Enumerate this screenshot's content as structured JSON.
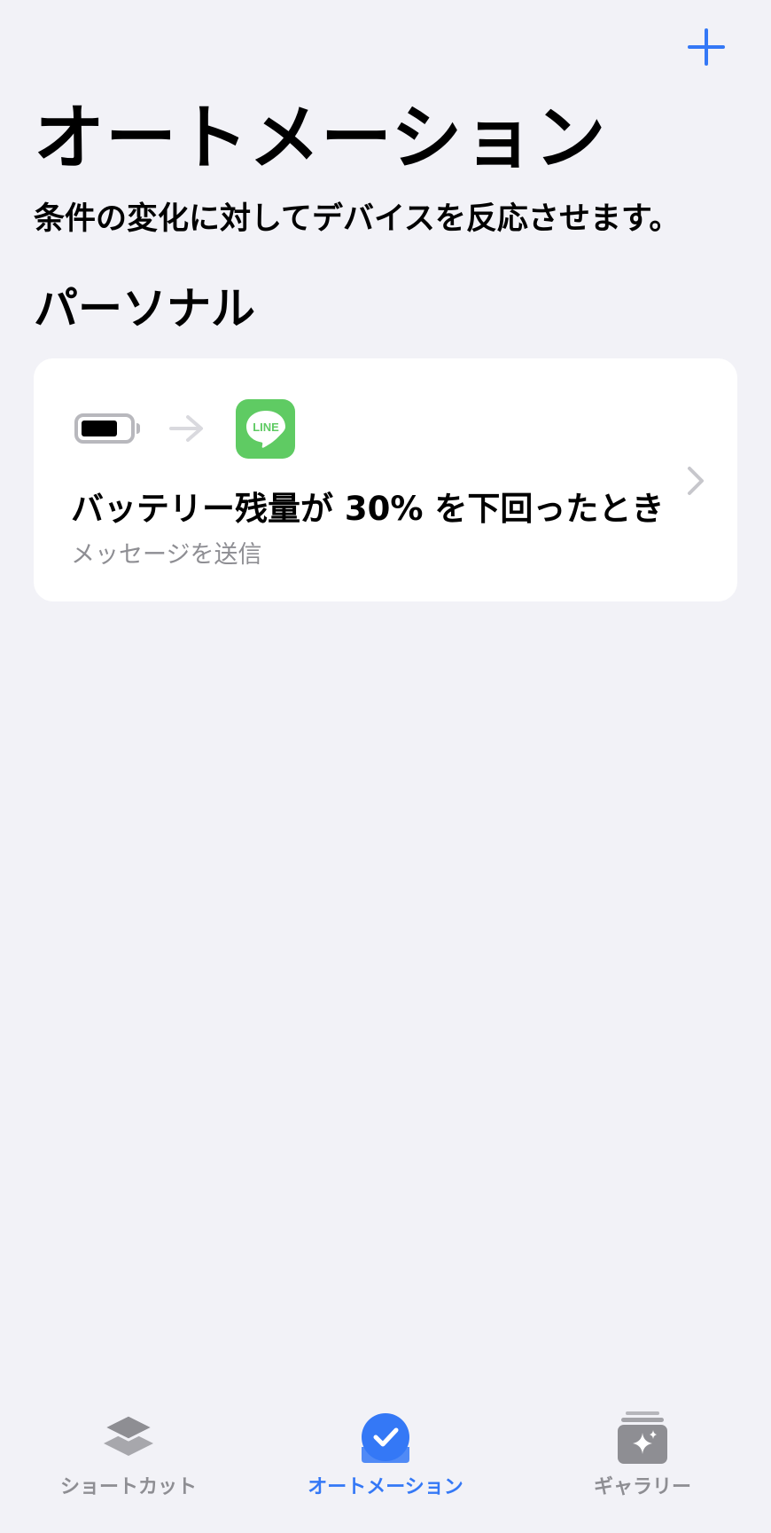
{
  "header": {
    "title": "オートメーション",
    "subtitle": "条件の変化に対してデバイスを反応させます。",
    "add_icon": "plus-icon"
  },
  "section": {
    "title": "パーソナル"
  },
  "automation": {
    "trigger_icon": "battery-icon",
    "action_icon": "line-app-icon",
    "action_icon_text": "LINE",
    "title": "バッテリー残量が 30% を下回ったとき",
    "subtitle": "メッセージを送信"
  },
  "tabs": [
    {
      "label": "ショートカット",
      "icon": "layers-icon",
      "active": false
    },
    {
      "label": "オートメーション",
      "icon": "checkmark-circle-icon",
      "active": true
    },
    {
      "label": "ギャラリー",
      "icon": "gallery-sparkle-icon",
      "active": false
    }
  ],
  "colors": {
    "accent": "#3478f6",
    "background": "#f2f2f7",
    "card": "#ffffff",
    "secondary_text": "#8e8e93",
    "line_green": "#5fcb63"
  }
}
